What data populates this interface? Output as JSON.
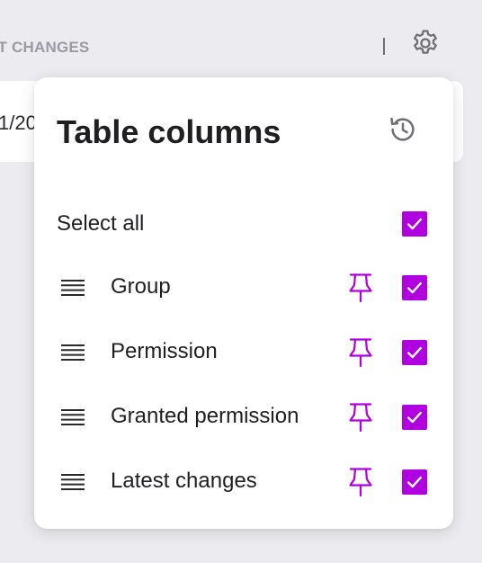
{
  "background": {
    "column_header": "ST CHANGES",
    "row_date_fragment": "1/20",
    "settings_icon": "gear-icon"
  },
  "panel": {
    "title": "Table columns",
    "reset_icon": "history-icon",
    "select_all": {
      "label": "Select all",
      "checked": true
    },
    "columns": [
      {
        "label": "Group",
        "pinned_icon": "pin-icon",
        "checked": true
      },
      {
        "label": "Permission",
        "pinned_icon": "pin-icon",
        "checked": true
      },
      {
        "label": "Granted permission",
        "pinned_icon": "pin-icon",
        "checked": true
      },
      {
        "label": "Latest changes",
        "pinned_icon": "pin-icon",
        "checked": true
      }
    ]
  },
  "colors": {
    "accent": "#b000e0",
    "text": "#1f1f22",
    "muted": "#9a9aa2",
    "background": "#ebebf0"
  }
}
